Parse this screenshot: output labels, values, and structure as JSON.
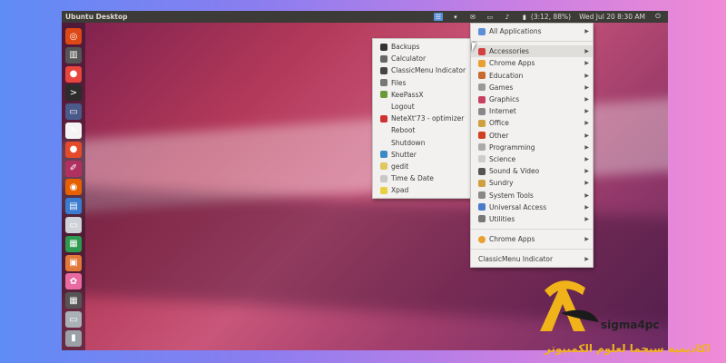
{
  "topbar": {
    "title": "Ubuntu Desktop",
    "battery": "(3:12, 88%)",
    "clock": "Wed Jul 20  8:30 AM"
  },
  "launcher": [
    {
      "name": "ubuntu-icon",
      "color": "#dd4814",
      "glyph": "◎"
    },
    {
      "name": "mixer-icon",
      "color": "#555",
      "glyph": "▥"
    },
    {
      "name": "chrome-icon",
      "color": "#e8453c",
      "glyph": "●"
    },
    {
      "name": "terminal-icon",
      "color": "#2c2c2c",
      "glyph": ">"
    },
    {
      "name": "display-icon",
      "color": "#4a5a8a",
      "glyph": "▭"
    },
    {
      "name": "document-icon",
      "color": "#f4f4f4",
      "glyph": "✎"
    },
    {
      "name": "store-icon",
      "color": "#e54a2a",
      "glyph": "●"
    },
    {
      "name": "pen-icon",
      "color": "#b03060",
      "glyph": "✐"
    },
    {
      "name": "firefox-icon",
      "color": "#e66000",
      "glyph": "◉"
    },
    {
      "name": "writer-icon",
      "color": "#3b7bd0",
      "glyph": "▤"
    },
    {
      "name": "drive-icon",
      "color": "#cfd3d8",
      "glyph": "▭"
    },
    {
      "name": "calc-icon",
      "color": "#2e9a4f",
      "glyph": "▦"
    },
    {
      "name": "impress-icon",
      "color": "#e2783a",
      "glyph": "▣"
    },
    {
      "name": "flower-icon",
      "color": "#e86aa0",
      "glyph": "✿"
    },
    {
      "name": "keyboard-icon",
      "color": "#555",
      "glyph": "▦"
    },
    {
      "name": "disk-icon",
      "color": "#aab0b8",
      "glyph": "▭"
    },
    {
      "name": "trash-icon",
      "color": "#9aa0a6",
      "glyph": "▮"
    }
  ],
  "accessories_menu": [
    {
      "label": "Backups",
      "icon": "backups-icon",
      "color": "#333"
    },
    {
      "label": "Calculator",
      "icon": "calculator-icon",
      "color": "#666"
    },
    {
      "label": "ClassicMenu Indicator",
      "icon": "classicmenu-icon",
      "color": "#444"
    },
    {
      "label": "Files",
      "icon": "files-icon",
      "color": "#777"
    },
    {
      "label": "KeePassX",
      "icon": "keepassx-icon",
      "color": "#6a9a3a"
    },
    {
      "label": "Logout",
      "icon": "",
      "color": ""
    },
    {
      "label": "NeteXt'73 - optimizer",
      "icon": "netext-icon",
      "color": "#d03030"
    },
    {
      "label": "Reboot",
      "icon": "",
      "color": ""
    },
    {
      "label": "Shutdown",
      "icon": "",
      "color": ""
    },
    {
      "label": "Shutter",
      "icon": "shutter-icon",
      "color": "#3a8ac8"
    },
    {
      "label": "gedit",
      "icon": "gedit-icon",
      "color": "#e0c860"
    },
    {
      "label": "Time & Date",
      "icon": "clock-icon",
      "color": "#c8c8c8"
    },
    {
      "label": "Xpad",
      "icon": "xpad-icon",
      "color": "#e8d040"
    }
  ],
  "main_menu": {
    "top": {
      "label": "All Applications",
      "icon": "all-apps-icon",
      "color": "#5a8fd8"
    },
    "items": [
      {
        "label": "Accessories",
        "icon": "accessories-icon",
        "color": "#d04040"
      },
      {
        "label": "Chrome Apps",
        "icon": "chrome-apps-icon",
        "color": "#e8a030"
      },
      {
        "label": "Education",
        "icon": "education-icon",
        "color": "#c86a30"
      },
      {
        "label": "Games",
        "icon": "games-icon",
        "color": "#999"
      },
      {
        "label": "Graphics",
        "icon": "graphics-icon",
        "color": "#c84060"
      },
      {
        "label": "Internet",
        "icon": "internet-icon",
        "color": "#888"
      },
      {
        "label": "Office",
        "icon": "office-icon",
        "color": "#d0a040"
      },
      {
        "label": "Other",
        "icon": "other-icon",
        "color": "#d04020"
      },
      {
        "label": "Programming",
        "icon": "programming-icon",
        "color": "#aaa"
      },
      {
        "label": "Science",
        "icon": "science-icon",
        "color": "#ccc"
      },
      {
        "label": "Sound & Video",
        "icon": "sound-video-icon",
        "color": "#555"
      },
      {
        "label": "Sundry",
        "icon": "sundry-icon",
        "color": "#d0a040"
      },
      {
        "label": "System Tools",
        "icon": "system-tools-icon",
        "color": "#888"
      },
      {
        "label": "Universal Access",
        "icon": "universal-access-icon",
        "color": "#4a7ac8"
      },
      {
        "label": "Utilities",
        "icon": "utilities-icon",
        "color": "#777"
      }
    ],
    "bottom1": {
      "label": "Chrome Apps",
      "icon": "chrome-icon",
      "color": "#e8a030"
    },
    "bottom2": {
      "label": "ClassicMenu Indicator"
    }
  },
  "logo": {
    "text": "sigma4pc",
    "arabic": "اكاديمية سيجما لعلوم الكمبيوتر",
    "brand_color": "#f0b31a"
  }
}
